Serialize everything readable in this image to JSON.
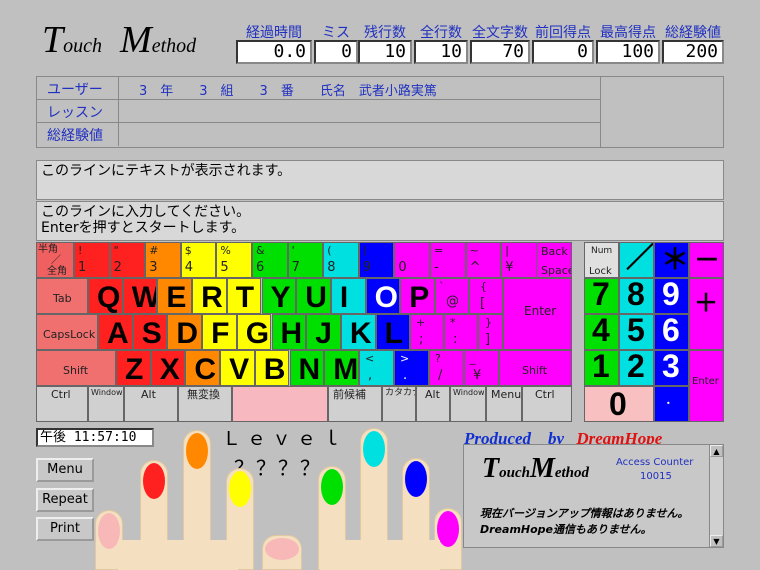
{
  "app": {
    "logo_t": "T",
    "logo_ouch": "ouch",
    "logo_m": "M",
    "logo_ethod": "ethod"
  },
  "stats": [
    {
      "label": "経過時間",
      "value": "0.0"
    },
    {
      "label": "ミス",
      "value": "0"
    },
    {
      "label": "残行数",
      "value": "10"
    },
    {
      "label": "全行数",
      "value": "10"
    },
    {
      "label": "全文字数",
      "value": "70"
    },
    {
      "label": "前回得点",
      "value": "0"
    },
    {
      "label": "最高得点",
      "value": "100"
    },
    {
      "label": "総経験値",
      "value": "200"
    }
  ],
  "info": {
    "user_label": "ユーザー",
    "user_value": "3　年　　3　組　　3　番　　氏名　武者小路実篤",
    "lesson_label": "レッスン",
    "lesson_value": "",
    "exp_label": "総経験値",
    "exp_value": ""
  },
  "text_line": "このラインにテキストが表示されます。",
  "input_line1": "このラインに入力してください。",
  "input_line2": "Enterを押すとスタートします。",
  "clock": "午後 11:57:10",
  "level_label": "Ｌｅｖｅｌ",
  "level_value": "？？？？",
  "buttons": {
    "menu": "Menu",
    "repeat": "Repeat",
    "print": "Print"
  },
  "produced": {
    "by": "Produced　by",
    "name": "DreamHope"
  },
  "news": {
    "logo_t": "T",
    "logo_ouch": "ouch",
    "logo_m": "M",
    "logo_ethod": "ethod",
    "counter_label": "Access Counter",
    "counter_value": "10015",
    "msg1": "現在バージョンアップ情報はありません。",
    "msg2": "DreamHope通信もありません。"
  },
  "keys": {
    "hankaku_top": "半角",
    "hankaku_mid": "／",
    "hankaku_bot": "全角",
    "tab": "Tab",
    "capslock": "CapsLock",
    "shift_l": "Shift",
    "shift_r": "Shift",
    "ctrl_l": "Ctrl",
    "ctrl_r": "Ctrl",
    "windows_l": "Windows",
    "windows_r": "Windows",
    "alt_l": "Alt",
    "alt_r": "Alt",
    "muhenkan": "無変換",
    "zenkouho": "前候補",
    "katakana": "カタカナ",
    "menu": "Menu",
    "back": "Back",
    "space": "Space",
    "enter": "Enter",
    "numlock_top": "Num",
    "numlock_bot": "Lock",
    "np_enter": "Enter",
    "q": "Q",
    "w": "W",
    "e": "E",
    "r": "R",
    "t": "T",
    "y": "Y",
    "u": "U",
    "i": "I",
    "o": "O",
    "p": "P",
    "a": "A",
    "s": "S",
    "d": "D",
    "f": "F",
    "g": "G",
    "h": "H",
    "j": "J",
    "k": "K",
    "l": "L",
    "z": "Z",
    "x": "X",
    "c": "C",
    "v": "V",
    "b": "B",
    "n": "N",
    "m": "M",
    "n7": "7",
    "n8": "8",
    "n9": "9",
    "n4": "4",
    "n5": "5",
    "n6": "6",
    "n1": "1",
    "n2": "2",
    "n3": "3",
    "n0": "0",
    "slash": "／",
    "star": "＊",
    "minus": "－",
    "plus": "＋",
    "dot": "．"
  },
  "colors": {
    "red": "#ff2020",
    "orange": "#ff8800",
    "yellow": "#ffff00",
    "green": "#00e000",
    "cyan": "#00e0e0",
    "blue": "#0000ff",
    "magenta": "#ff00ff",
    "pink": "#f8b8b8"
  }
}
